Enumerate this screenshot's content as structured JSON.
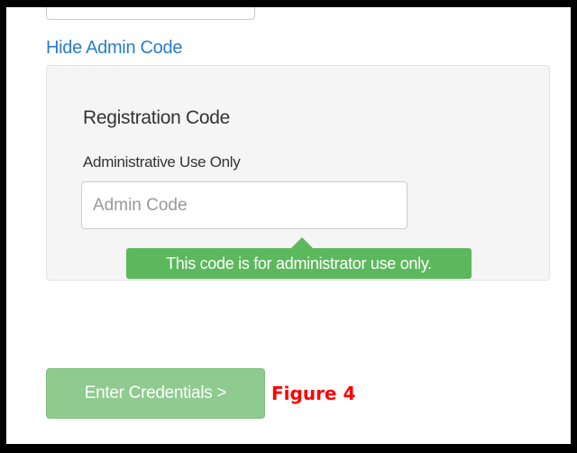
{
  "hide_link": "Hide Admin Code",
  "panel": {
    "title": "Registration Code",
    "field_label": "Administrative Use Only",
    "input_placeholder": "Admin Code",
    "input_value": ""
  },
  "tooltip": "This code is for administrator use only.",
  "submit_button": "Enter Credentials >",
  "figure_caption": "Figure 4",
  "colors": {
    "link": "#2a7cc7",
    "tooltip_bg": "#5cb85c",
    "button_bg": "#8fca8f",
    "caption": "#ff0000"
  }
}
